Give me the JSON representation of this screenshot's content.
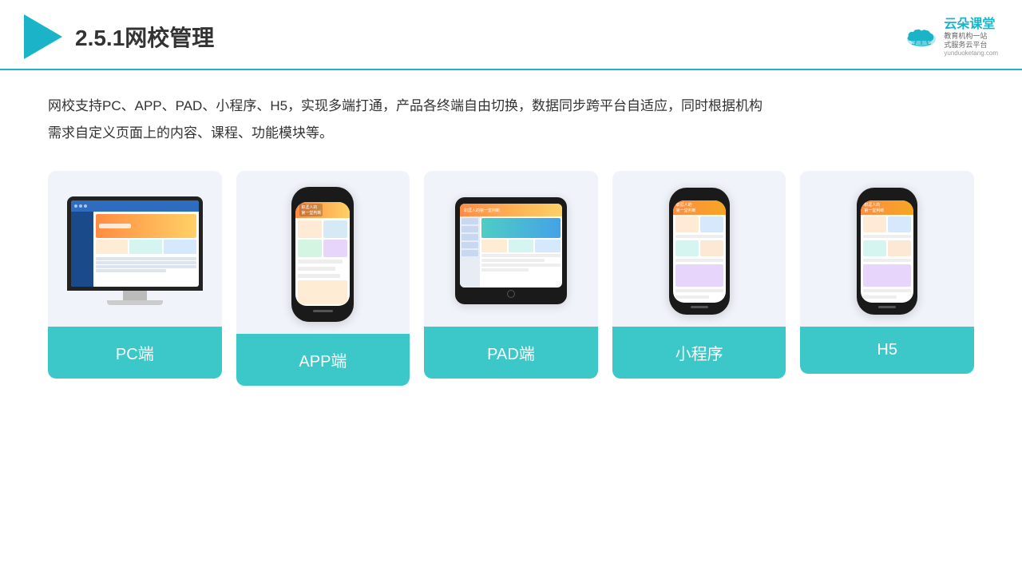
{
  "header": {
    "title": "2.5.1网校管理",
    "brand": {
      "name": "云朵课堂",
      "tagline": "教育机构一站\n式服务云平台",
      "url": "yunduoketang.com"
    }
  },
  "description": "网校支持PC、APP、PAD、小程序、H5，实现多端打通，产品各终端自由切换，数据同步跨平台自适应，同时根据机构\n需求自定义页面上的内容、课程、功能模块等。",
  "cards": [
    {
      "id": "pc",
      "label": "PC端"
    },
    {
      "id": "app",
      "label": "APP端"
    },
    {
      "id": "pad",
      "label": "PAD端"
    },
    {
      "id": "miniprogram",
      "label": "小程序"
    },
    {
      "id": "h5",
      "label": "H5"
    }
  ],
  "colors": {
    "accent": "#1ab3c8",
    "teal": "#3cc8c8",
    "header_border": "#1ab3c8"
  }
}
